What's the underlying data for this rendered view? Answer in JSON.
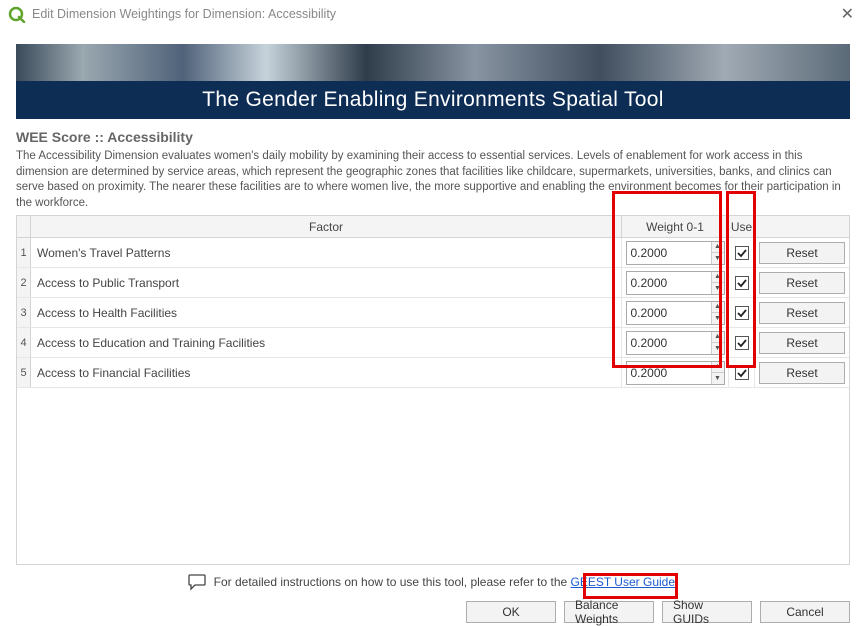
{
  "titlebar": {
    "title": "Edit Dimension Weightings for Dimension: Accessibility"
  },
  "banner": {
    "title": "The Gender Enabling Environments Spatial Tool"
  },
  "section_head": "WEE Score :: Accessibility",
  "description": "The Accessibility Dimension evaluates women's daily mobility by examining their access to essential services. Levels of enablement for work access in this dimension are determined by service areas, which represent the geographic zones that facilities like childcare, supermarkets, universities, banks, and clinics can serve based on proximity. The nearer these facilities are to where women live, the more supportive and enabling the environment becomes for their participation in the workforce.",
  "headers": {
    "factor": "Factor",
    "weight": "Weight 0-1",
    "use": "Use",
    "reset": ""
  },
  "rows": [
    {
      "idx": "1",
      "factor": "Women's Travel Patterns",
      "weight": "0.2000",
      "use": true
    },
    {
      "idx": "2",
      "factor": "Access to Public Transport",
      "weight": "0.2000",
      "use": true
    },
    {
      "idx": "3",
      "factor": "Access to Health Facilities",
      "weight": "0.2000",
      "use": true
    },
    {
      "idx": "4",
      "factor": "Access to Education and Training Facilities",
      "weight": "0.2000",
      "use": true
    },
    {
      "idx": "5",
      "factor": "Access to Financial Facilities",
      "weight": "0.2000",
      "use": true
    }
  ],
  "reset_label": "Reset",
  "footer_note": {
    "prefix": "For detailed instructions on how to use this tool, please refer to the ",
    "link": "GEEST User Guide",
    "suffix": "."
  },
  "buttons": {
    "ok": "OK",
    "balance": "Balance Weights",
    "guids": "Show GUIDs",
    "cancel": "Cancel"
  }
}
